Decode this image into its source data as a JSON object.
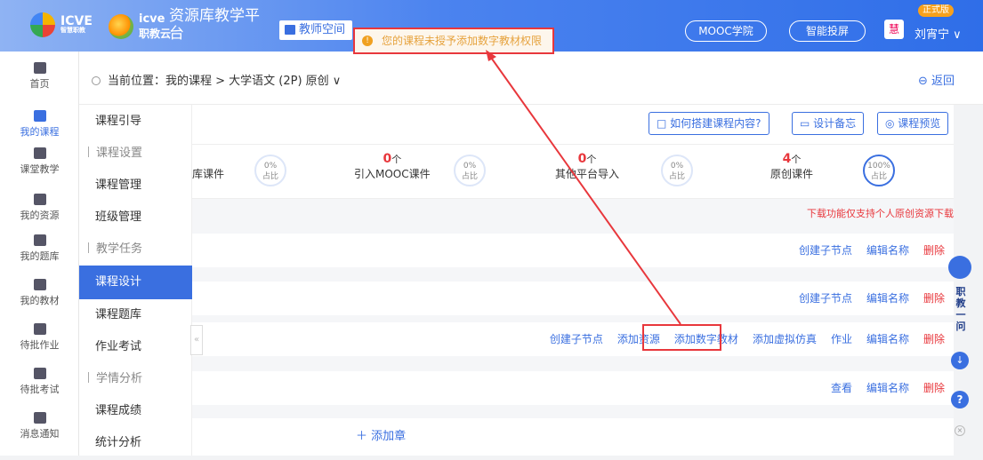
{
  "brand": {
    "logo1_title": "ICVE",
    "logo1_sub": "智慧职教",
    "logo2_title": "icve",
    "logo2_sub": "职教云",
    "site_title": "资源库教学平台"
  },
  "header": {
    "teacher_space": "教师空间",
    "mooc": "MOOC学院",
    "screen": "智能投屏",
    "badge": "正式版",
    "user": "刘宵宁 ∨",
    "avatar": "慧"
  },
  "warning": {
    "icon": "!",
    "text": "您的课程未授予添加数字教材权限"
  },
  "sidebar": {
    "items": [
      {
        "label": "首页"
      },
      {
        "label": "我的课程"
      },
      {
        "label": "课堂教学"
      },
      {
        "label": "我的资源"
      },
      {
        "label": "我的题库"
      },
      {
        "label": "我的教材"
      },
      {
        "label": "待批作业"
      },
      {
        "label": "待批考试"
      },
      {
        "label": "消息通知"
      }
    ]
  },
  "breadcrumb": {
    "text": "当前位置：我的课程 > 大学语文 (2P) 原创 ∨",
    "back": "⊖ 返回"
  },
  "submenu": [
    {
      "label": "课程引导"
    },
    {
      "label": "课程设置"
    },
    {
      "label": "课程管理"
    },
    {
      "label": "班级管理"
    },
    {
      "label": "教学任务"
    },
    {
      "label": "课程设计"
    },
    {
      "label": "课程题库"
    },
    {
      "label": "作业考试"
    },
    {
      "label": "学情分析"
    },
    {
      "label": "课程成绩"
    },
    {
      "label": "统计分析"
    }
  ],
  "toolbar": {
    "how": "□ 如何搭建课程内容?",
    "memo": "设计备忘",
    "preview": "◎ 课程预览"
  },
  "stats": [
    {
      "label": "库课件",
      "pct": "0%",
      "pct_label": "占比"
    },
    {
      "num": "0",
      "unit": "个",
      "label": "引入MOOC课件",
      "pct": "0%",
      "pct_label": "占比"
    },
    {
      "num": "0",
      "unit": "个",
      "label": "其他平台导入",
      "pct": "0%",
      "pct_label": "占比"
    },
    {
      "num": "4",
      "unit": "个",
      "label": "原创课件",
      "pct": "100%",
      "pct_label": "占比"
    }
  ],
  "hint": "下载功能仅支持个人原创资源下载",
  "rows": {
    "r1": {
      "a": "创建子节点",
      "b": "编辑名称",
      "c": "删除"
    },
    "r2": {
      "a": "创建子节点",
      "b": "编辑名称",
      "c": "删除"
    },
    "r3": {
      "a": "创建子节点",
      "b": "添加资源",
      "c": "添加数字教材",
      "d": "添加虚拟仿真",
      "e": "作业",
      "f": "编辑名称",
      "g": "删除"
    },
    "r4": {
      "a": "查看",
      "b": "编辑名称",
      "c": "删除"
    }
  },
  "add_chapter": "＋ 添加章",
  "collapse": "«",
  "float": {
    "text": "职教一问",
    "download": "↓",
    "help": "?",
    "close": "×"
  },
  "colors": {
    "accent": "#3a6fe0",
    "danger": "#e8373c",
    "warn": "#e6a23c"
  }
}
